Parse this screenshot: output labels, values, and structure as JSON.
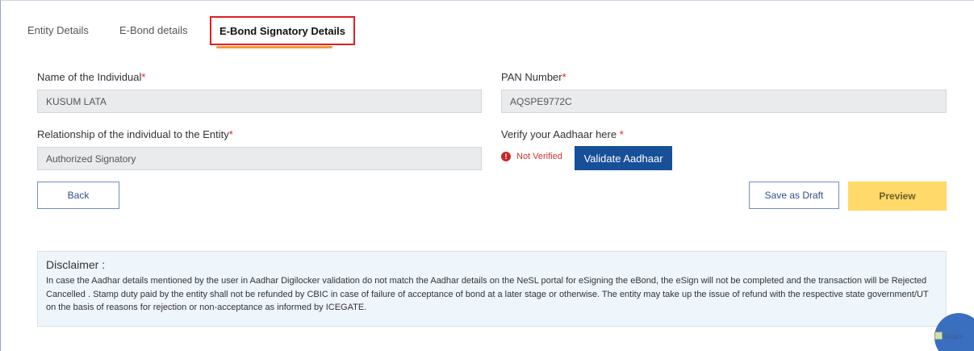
{
  "tabs": [
    {
      "label": "Entity Details"
    },
    {
      "label": "E-Bond details"
    },
    {
      "label": "E-Bond Signatory Details"
    }
  ],
  "form": {
    "name_label": "Name of the Individual",
    "name_value": "KUSUM LATA",
    "pan_label": "PAN Number",
    "pan_value": "AQSPE9772C",
    "relationship_label": "Relationship of the individual to the Entity",
    "relationship_value": "Authorized Signatory",
    "aadhaar_label": "Verify your Aadhaar here ",
    "required_mark": "*",
    "aadhaar_status": "Not Verified",
    "aadhaar_status_icon": "!",
    "validate_label": "Validate Aadhaar"
  },
  "actions": {
    "back_label": "Back",
    "save_draft_label": "Save as Draft",
    "preview_label": "Preview"
  },
  "disclaimer": {
    "title": "Disclaimer :",
    "text": "In case the Aadhar details mentioned by the user in Aadhar Digilocker validation do not match the Aadhar details on the NeSL portal for eSigning the eBond, the eSign will not be completed and the transaction will be Rejected Cancelled . Stamp duty paid by the entity shall not be refunded by CBIC in case of failure of acceptance of bond at a later stage or otherwise. The entity may take up the issue of refund with the respective state government/UT on the basis of reasons for rejection or non-acceptance as informed by ICEGATE."
  },
  "chat": {
    "alt_text": "Vaani"
  },
  "colors": {
    "active_tab_border": "#e21d25",
    "tab_underline": "#f29a3a",
    "primary_button": "#184f99",
    "preview_button": "#ffd969",
    "disclaimer_bg": "#eef5fb",
    "error": "#c62828"
  }
}
